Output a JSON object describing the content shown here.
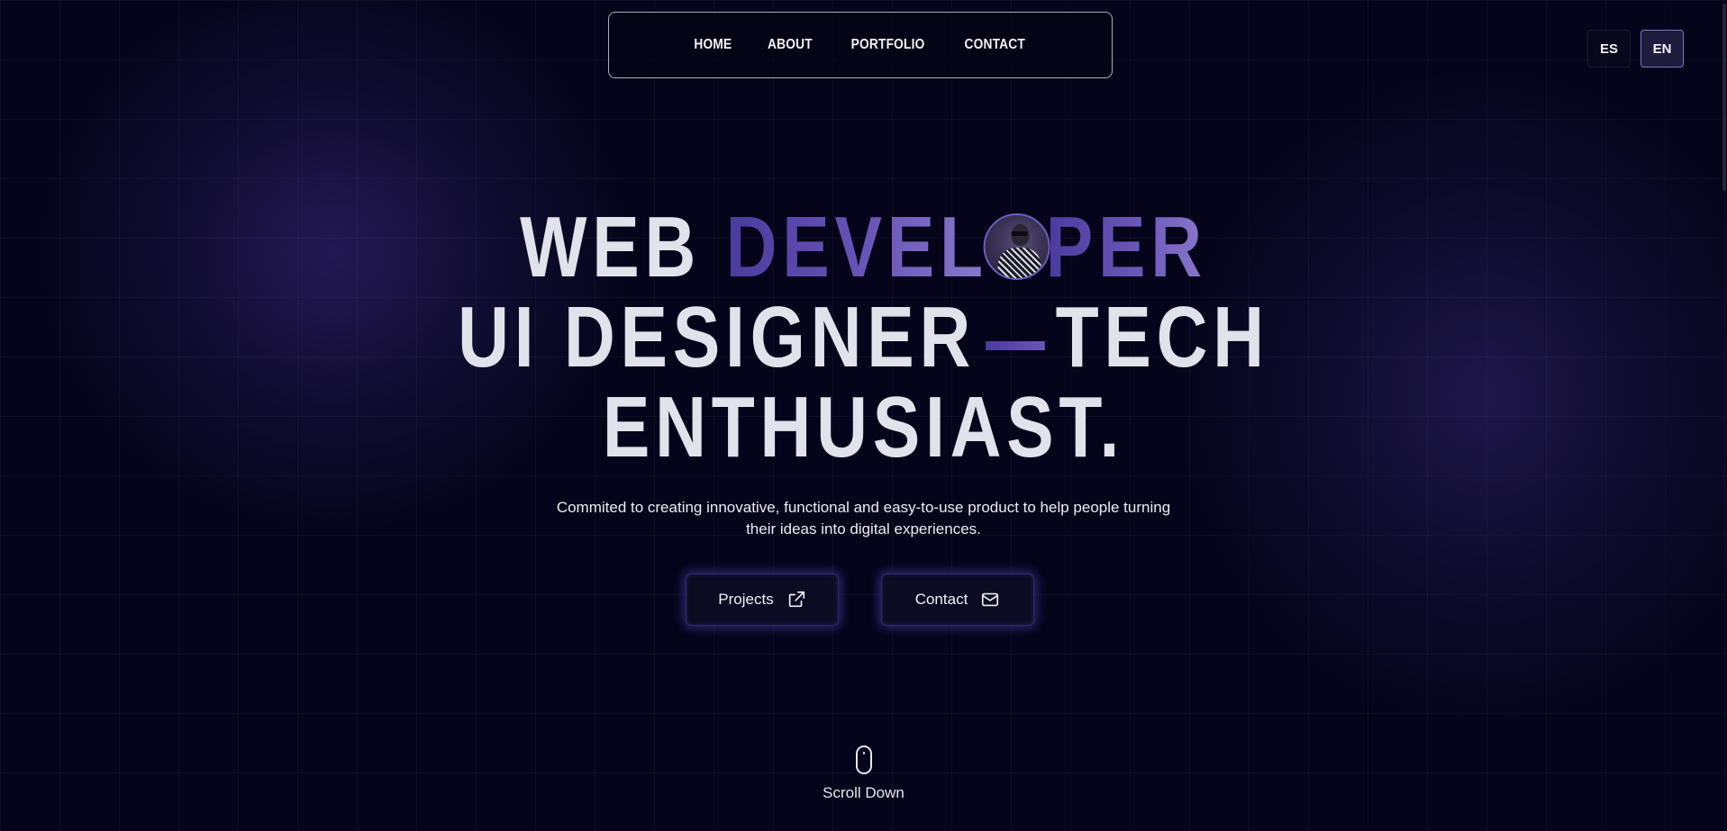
{
  "nav": {
    "items": [
      {
        "label": "HOME"
      },
      {
        "label": "ABOUT"
      },
      {
        "label": "PORTFOLIO"
      },
      {
        "label": "CONTACT"
      }
    ]
  },
  "language": {
    "options": [
      "ES",
      "EN"
    ],
    "selected": "EN"
  },
  "hero": {
    "line1_part1": "WEB",
    "line1_accent_a": "DEVEL",
    "line1_accent_b": "PER",
    "line2_part1": "UI DESIGNER",
    "line2_part2": "TECH",
    "line3": "ENTHUSIAST."
  },
  "subtitle": {
    "line1": "Commited to creating innovative, functional and easy-to-use product to help people turning",
    "line2": "their ideas into digital experiences."
  },
  "buttons": {
    "projects": {
      "label": "Projects",
      "icon": "external-link-icon"
    },
    "contact": {
      "label": "Contact",
      "icon": "mail-icon"
    }
  },
  "scroll": {
    "label": "Scroll Down",
    "icon": "mouse-icon"
  },
  "colors": {
    "background": "#05041a",
    "accent_start": "#4b3a9e",
    "accent_end": "#8a78cc",
    "text": "#e2e2ea",
    "button_glow": "#5f46d2"
  }
}
